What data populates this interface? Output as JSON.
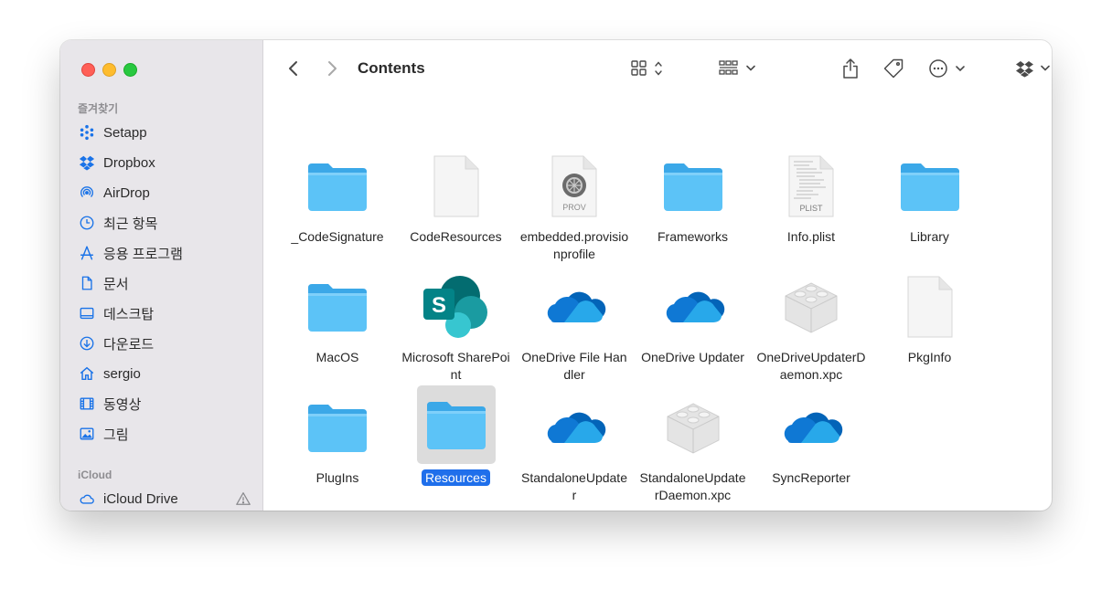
{
  "window": {
    "title": "Contents"
  },
  "sidebar": {
    "sections": [
      {
        "label": "즐겨찾기"
      },
      {
        "label": "iCloud"
      }
    ],
    "favorites": [
      {
        "label": "Setapp",
        "icon": "setapp-icon"
      },
      {
        "label": "Dropbox",
        "icon": "dropbox-icon"
      },
      {
        "label": "AirDrop",
        "icon": "airdrop-icon"
      },
      {
        "label": "최근 항목",
        "icon": "clock-icon"
      },
      {
        "label": "응용 프로그램",
        "icon": "applications-icon"
      },
      {
        "label": "문서",
        "icon": "document-icon"
      },
      {
        "label": "데스크탑",
        "icon": "desktop-icon"
      },
      {
        "label": "다운로드",
        "icon": "download-icon"
      },
      {
        "label": "sergio",
        "icon": "home-icon"
      },
      {
        "label": "동영상",
        "icon": "film-icon"
      },
      {
        "label": "그림",
        "icon": "photo-icon"
      }
    ],
    "icloud": [
      {
        "label": "iCloud Drive",
        "icon": "cloud-icon",
        "status": "warning-icon"
      }
    ],
    "accent": "#1a73e8"
  },
  "toolbar": {
    "back": "back-chevron-icon",
    "forward": "forward-chevron-icon",
    "view_mode": "icon-grid-view-icon",
    "group": "group-by-icon",
    "share": "share-icon",
    "tag": "tag-icon",
    "more": "ellipsis-circle-icon",
    "dropbox": "dropbox-icon",
    "search": "search-icon"
  },
  "files": [
    {
      "name": "_CodeSignature",
      "kind": "folder"
    },
    {
      "name": "CodeResources",
      "kind": "blank-doc"
    },
    {
      "name": "embedded.provisionprofile",
      "kind": "prov-doc",
      "badge": "PROV"
    },
    {
      "name": "Frameworks",
      "kind": "folder"
    },
    {
      "name": "Info.plist",
      "kind": "plist-doc",
      "badge": "PLIST"
    },
    {
      "name": "Library",
      "kind": "folder"
    },
    {
      "name": "MacOS",
      "kind": "folder"
    },
    {
      "name": "Microsoft SharePoint",
      "kind": "sharepoint-app",
      "glyph": "S"
    },
    {
      "name": "OneDrive File Handler",
      "kind": "onedrive-app"
    },
    {
      "name": "OneDrive Updater",
      "kind": "onedrive-app"
    },
    {
      "name": "OneDriveUpdaterDaemon.xpc",
      "kind": "xpc-bundle"
    },
    {
      "name": "PkgInfo",
      "kind": "blank-doc"
    },
    {
      "name": "PlugIns",
      "kind": "folder"
    },
    {
      "name": "Resources",
      "kind": "folder",
      "selected": true
    },
    {
      "name": "StandaloneUpdater",
      "kind": "onedrive-app"
    },
    {
      "name": "StandaloneUpdaterDaemon.xpc",
      "kind": "xpc-bundle"
    },
    {
      "name": "SyncReporter",
      "kind": "onedrive-app"
    }
  ],
  "colors": {
    "folder": "#5cc3f7",
    "folder_tab": "#3ba8e8",
    "selection": "#1f6feb",
    "sharepoint": "#038387",
    "onedrive": "#0f78d4"
  }
}
